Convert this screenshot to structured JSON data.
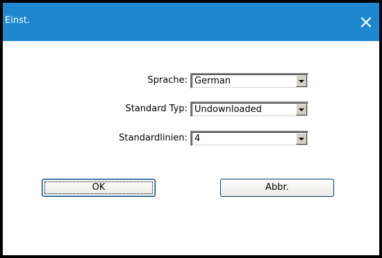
{
  "window": {
    "title": "Einst.",
    "close_icon": "close-icon"
  },
  "form": {
    "language": {
      "label": "Sprache:",
      "value": "German"
    },
    "default_type": {
      "label": "Standard Typ:",
      "value": "Undownloaded"
    },
    "default_lines": {
      "label": "Standardlinien:",
      "value": "4"
    }
  },
  "buttons": {
    "ok_label": "OK",
    "cancel_label": "Abbr."
  },
  "colors": {
    "titlebar": "#1e87d0",
    "frame": "#000000",
    "background": "#ffffff"
  }
}
